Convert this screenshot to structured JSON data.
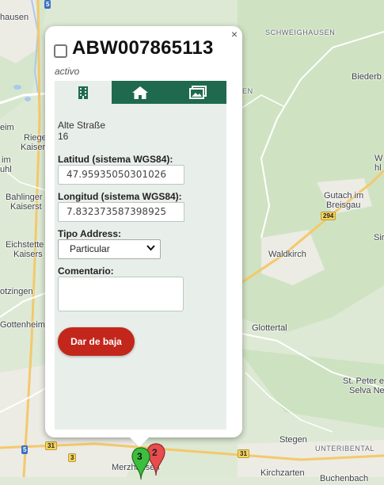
{
  "popup": {
    "title": "ABW007865113",
    "status": "activo",
    "close_symbol": "×",
    "tabs": [
      {
        "icon": "building-icon",
        "active": true
      },
      {
        "icon": "home-icon",
        "active": false
      },
      {
        "icon": "image-icon",
        "active": false
      }
    ],
    "address_line1": "Alte Straße",
    "address_line2": "16",
    "lat_label": "Latitud (sistema WGS84):",
    "lat_value": "47.95935050301026",
    "lon_label": "Longitud (sistema WGS84):",
    "lon_value": "7.832373587398925",
    "tipo_label": "Tipo Address:",
    "tipo_value": "Particular",
    "comentario_label": "Comentario:",
    "comentario_value": "",
    "baja_button": "Dar de baja"
  },
  "map": {
    "labels": {
      "hausen": "hausen",
      "schweighausen": "SCHWEIGHAUSEN",
      "biederb": "Biederb",
      "en": "EN",
      "eim": "eim",
      "riege": "Riege",
      "kaiser": "Kaiser",
      "uhl": "uhl",
      "w": "W",
      "im": "im",
      "hl": "hl",
      "bahlinger": "Bahlinger",
      "kaiserst": "Kaiserst",
      "gutach1": "Gutach im",
      "gutach2": "Breisgau",
      "sir": "Sir",
      "eichstetten": "Eichstette",
      "kaisers": "Kaisers",
      "waldkirch": "Waldkirch",
      "otzingen": "otzingen",
      "gottenheim": "Gottenheim",
      "glottertal": "Glottertal",
      "stpeter1": "St. Peter e",
      "stpeter2": "Selva Ne",
      "stegen": "Stegen",
      "unterbiental": "UNTERIBENTAL",
      "merzhausen": "Merzhausen",
      "kirchzarten": "Kirchzarten",
      "buchenbach": "Buchenbach"
    },
    "shields": {
      "s5_top": "5",
      "s294": "294",
      "s5_bottom": "5",
      "s31_a": "31",
      "s3": "3",
      "s31_b": "31"
    },
    "markers": [
      {
        "label": "3",
        "color": "#3cbf3c"
      },
      {
        "label": "2",
        "color": "#e84c4c"
      }
    ]
  }
}
